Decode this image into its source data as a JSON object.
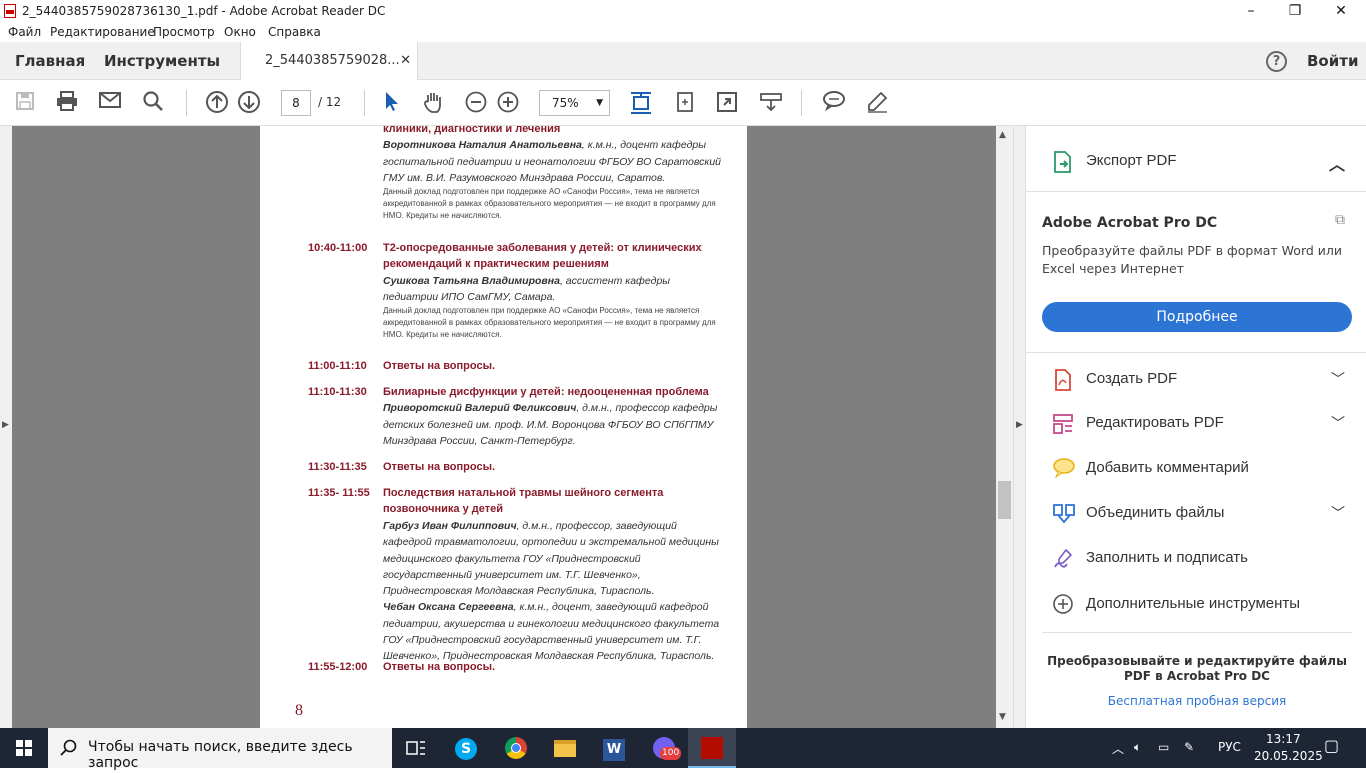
{
  "window": {
    "title": "2_5440385759028736130_1.pdf - Adobe Acrobat Reader DC",
    "minimize": "–",
    "maximize": "❐",
    "close": "✕"
  },
  "menu": [
    "Файл",
    "Редактирование",
    "Просмотр",
    "Окно",
    "Справка"
  ],
  "tabs": {
    "home": "Главная",
    "tools": "Инструменты",
    "doc": "2_5440385759028...",
    "doc_close": "✕",
    "help": "?",
    "signin": "Войти"
  },
  "toolbar": {
    "page_current": "8",
    "page_total": "/  12",
    "zoom": "75%",
    "zoom_arrow": "▼"
  },
  "document": {
    "top_heading": "клиники, диагностики и лечения",
    "top_author": "Воротникова Наталия Анатольевна",
    "top_author_rest": ", к.м.н., доцент кафедры госпитальной педиатрии и неонатологии ФГБОУ ВО Саратовский ГМУ им. В.И. Разумовского Минздрава России, Саратов.",
    "top_note": "Данный доклад подготовлен при поддержке АО «Санофи Россия», тема не является аккредитованной в рамках образовательного мероприятия — не входит в программу для НМО. Кредиты не начисляются.",
    "items": [
      {
        "time": "10:40-11:00",
        "title": "Т2-опосредованные заболевания у детей: от клинических рекомендаций к практическим решениям",
        "author": "Сушкова Татьяна Владимировна",
        "author_rest": ", ассистент кафедры педиатрии ИПО СамГМУ, Самара.",
        "note": "Данный доклад подготовлен при поддержке АО «Санофи Россия», тема не является аккредитованной в рамках образовательного мероприятия — не входит в программу для НМО. Кредиты не начисляются."
      },
      {
        "time": "11:00-11:10",
        "title": "Ответы на вопросы."
      },
      {
        "time": "11:10-11:30",
        "title": "Билиарные дисфункции у детей: недооцененная проблема",
        "author": "Приворотский Валерий Феликсович",
        "author_rest": ", д.м.н., профессор кафедры детских болезней им. проф. И.М. Воронцова ФГБОУ ВО СПбГПМУ Минздрава России, Санкт-Петербург."
      },
      {
        "time": "11:30-11:35",
        "title": "Ответы на вопросы."
      },
      {
        "time": "11:35- 11:55",
        "title": "Последствия натальной травмы шейного сегмента позвоночника у детей",
        "author": "Гарбуз Иван Филиппович",
        "author_rest": ", д.м.н., профессор, заведующий кафедрой травматологии, ортопедии и экстремальной медицины медицинского факультета ГОУ «Приднестровский государственный университет им. Т.Г. Шевченко», Приднестровская Молдавская Республика, Тирасполь.",
        "author2": "Чебан Оксана Сергеевна",
        "author2_rest": ", к.м.н., доцент, заведующий кафедрой педиатрии, акушерства и гинекологии медицинского факультета ГОУ «Приднестровский государственный университет им. Т.Г. Шевченко», Приднестровская Молдавская Республика, Тирасполь."
      },
      {
        "time": "11:55-12:00",
        "title": "Ответы на вопросы."
      }
    ],
    "page_number": "8"
  },
  "panel": {
    "export_title": "Экспорт PDF",
    "product": "Adobe Acrobat Pro DC",
    "desc": "Преобразуйте файлы PDF в формат Word или Excel через Интернет",
    "more_button": "Подробнее",
    "tools": [
      {
        "label": "Создать PDF"
      },
      {
        "label": "Редактировать PDF"
      },
      {
        "label": "Добавить комментарий"
      },
      {
        "label": "Объединить файлы"
      },
      {
        "label": "Заполнить и подписать"
      },
      {
        "label": "Дополнительные инструменты"
      }
    ],
    "promo": "Преобразовывайте и редактируйте файлы PDF в Acrobat Pro DC",
    "trial": "Бесплатная пробная версия"
  },
  "taskbar": {
    "search": "Чтобы начать поиск, введите здесь запрос",
    "badge": "100",
    "lang": "РУС",
    "time": "13:17",
    "date": "20.05.2025"
  },
  "colors": {
    "accent": "#2d75d4",
    "heading": "#8a1c2a",
    "taskbar": "#1e2635"
  }
}
